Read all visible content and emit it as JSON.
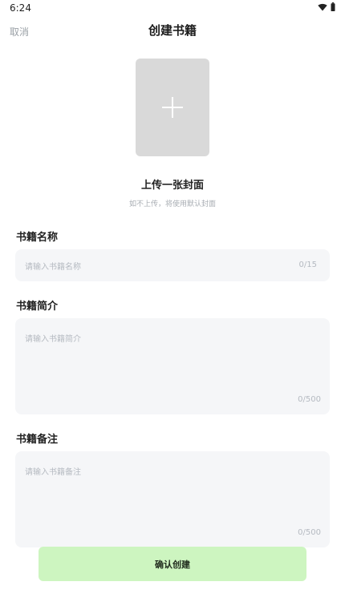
{
  "status_bar": {
    "time": "6:24",
    "icons": [
      "wifi-icon",
      "battery-icon"
    ]
  },
  "nav": {
    "cancel_label": "取消",
    "title": "创建书籍"
  },
  "cover": {
    "icon": "plus-icon",
    "title": "上传一张封面",
    "hint": "如不上传，将使用默认封面"
  },
  "fields": {
    "name": {
      "label": "书籍名称",
      "placeholder": "请输入书籍名称",
      "value": "",
      "counter": "0/15"
    },
    "intro": {
      "label": "书籍简介",
      "placeholder": "请输入书籍简介",
      "value": "",
      "counter": "0/500"
    },
    "note": {
      "label": "书籍备注",
      "placeholder": "请输入书籍备注",
      "value": "",
      "counter": "0/500"
    }
  },
  "confirm_button": {
    "label": "确认创建"
  },
  "colors": {
    "confirm_button_bg": "#cdf5c0",
    "input_bg": "#f5f6f8",
    "cover_placeholder_bg": "#d9d9d9"
  }
}
